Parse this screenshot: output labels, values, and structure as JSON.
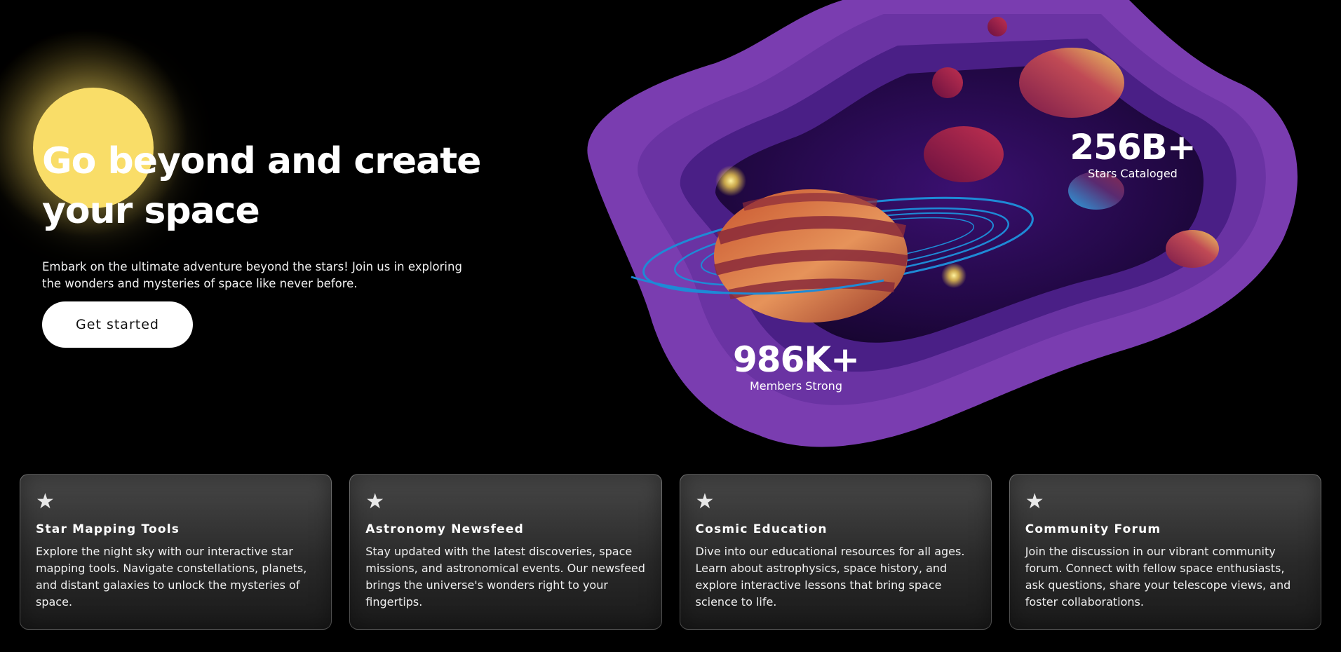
{
  "hero": {
    "title_line1": "Go beyond and create",
    "title_line2": "your space",
    "subtitle": "Embark on the ultimate adventure beyond the stars! Join us in exploring the wonders and mysteries of space like never before.",
    "cta_label": "Get started"
  },
  "stats": {
    "stars": {
      "value": "256B+",
      "label": "Stars Cataloged"
    },
    "members": {
      "value": "986K+",
      "label": "Members Strong"
    }
  },
  "colors": {
    "background": "#000000",
    "sun": "#f9dd68",
    "purple_outer": "#7a3db0",
    "purple_mid": "#5a2a93",
    "purple_inner": "#24094a",
    "ring": "#1e8ad6"
  },
  "features": [
    {
      "icon": "star-icon",
      "title": "Star Mapping Tools",
      "text": "Explore the night sky with our interactive star mapping tools. Navigate constellations, planets, and distant galaxies to unlock the mysteries of space."
    },
    {
      "icon": "star-icon",
      "title": "Astronomy Newsfeed",
      "text": "Stay updated with the latest discoveries, space missions, and astronomical events. Our newsfeed brings the universe's wonders right to your fingertips."
    },
    {
      "icon": "star-icon",
      "title": "Cosmic Education",
      "text": "Dive into our educational resources for all ages. Learn about astrophysics, space history, and explore interactive lessons that bring space science to life."
    },
    {
      "icon": "star-icon",
      "title": "Community Forum",
      "text": "Join the discussion in our vibrant community forum. Connect with fellow space enthusiasts, ask questions, share your telescope views, and foster collaborations."
    }
  ]
}
